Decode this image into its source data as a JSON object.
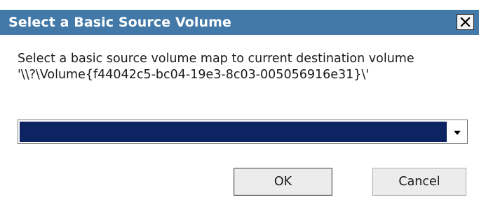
{
  "window": {
    "title": "Select a Basic Source Volume",
    "close_icon": "close-icon",
    "titlebar_color": "#4279a8"
  },
  "message": {
    "line1": "Select a basic source volume map to current destination volume",
    "line2": "'\\\\?\\Volume{f44042c5-bc04-19e3-8c03-005056916e31}\\'"
  },
  "combo": {
    "selected_value": "",
    "highlight_color": "#0c2461",
    "arrow_icon": "dropdown-arrow-icon"
  },
  "buttons": {
    "ok_label": "OK",
    "cancel_label": "Cancel"
  }
}
